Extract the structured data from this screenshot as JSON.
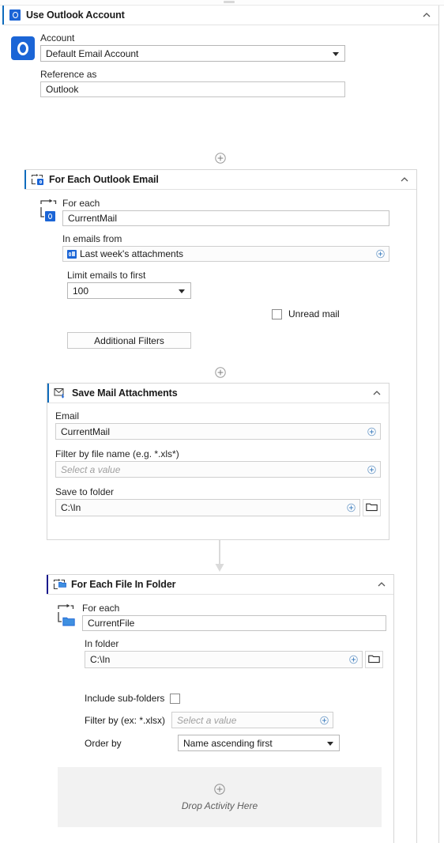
{
  "theme": {
    "accent_blue": "#0f6cbd",
    "outlook_blue": "#1b65d6",
    "scope_bar_outer": "#7aa8d6",
    "scope_bar_mid": "#4a86c8",
    "scope_bar_inner": "#1a1a8c",
    "panel_border": "#d6d6d6",
    "dropzone_bg": "#f2f2f2"
  },
  "outlook_account": {
    "title": "Use Outlook Account",
    "icon": "outlook-icon",
    "collapse_icon": "chevron-up-icon",
    "big_icon": "outlook-large-icon",
    "account_label": "Account",
    "account_value": "Default Email Account",
    "account_dropdown_icon": "chevron-down-icon",
    "reference_label": "Reference as",
    "reference_value": "Outlook"
  },
  "connector_1": {
    "icon": "plus-circle-icon"
  },
  "for_each_outlook_email": {
    "title": "For Each Outlook Email",
    "icon": "for-each-outlook-icon",
    "collapse_icon": "chevron-up-icon",
    "loop_icon": "loop-arrow-icon",
    "item_icon": "outlook-small-icon",
    "for_each_label": "For each",
    "for_each_value": "CurrentMail",
    "in_emails_label": "In emails from",
    "in_emails_value": "Last week's attachments",
    "in_emails_icon": "outlook-folder-icon",
    "in_emails_plus": "plus-circle-icon",
    "limit_label": "Limit emails to first",
    "limit_value": "100",
    "limit_dropdown_icon": "chevron-down-icon",
    "unread_checkbox_label": "Unread mail",
    "unread_checked": false,
    "additional_filters_label": "Additional Filters"
  },
  "connector_2": {
    "icon": "plus-circle-icon"
  },
  "save_mail_attachments": {
    "title": "Save Mail Attachments",
    "icon": "save-mail-attachment-icon",
    "collapse_icon": "chevron-up-icon",
    "email_label": "Email",
    "email_value": "CurrentMail",
    "email_plus": "plus-circle-icon",
    "filter_label": "Filter by file name (e.g. *.xls*)",
    "filter_placeholder": "Select a value",
    "filter_plus": "plus-circle-icon",
    "save_folder_label": "Save to folder",
    "save_folder_value": "C:\\In",
    "save_folder_plus": "plus-circle-icon",
    "browse_icon": "folder-browse-icon"
  },
  "connector_arrow": {
    "icon": "arrow-down-icon"
  },
  "for_each_file_in_folder": {
    "title": "For Each File In Folder",
    "icon": "for-each-folder-icon",
    "collapse_icon": "chevron-up-icon",
    "loop_icon": "loop-arrow-icon",
    "item_icon": "folder-small-icon",
    "for_each_label": "For each",
    "for_each_value": "CurrentFile",
    "in_folder_label": "In folder",
    "in_folder_value": "C:\\In",
    "in_folder_plus": "plus-circle-icon",
    "browse_icon": "folder-browse-icon",
    "include_subfolders_label": "Include sub-folders",
    "include_subfolders_checked": false,
    "filter_by_label": "Filter by (ex: *.xlsx)",
    "filter_by_placeholder": "Select a value",
    "filter_by_plus": "plus-circle-icon",
    "order_by_label": "Order by",
    "order_by_value": "Name ascending first",
    "order_by_dropdown_icon": "chevron-down-icon",
    "dropzone_label": "Drop Activity Here",
    "dropzone_icon": "plus-circle-icon"
  }
}
